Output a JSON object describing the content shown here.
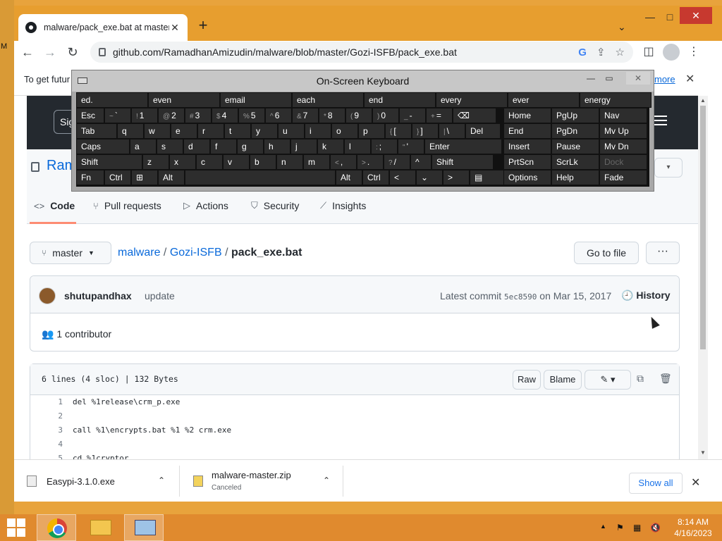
{
  "desktop": {
    "edge_letter": "M"
  },
  "browser": {
    "tab_title": "malware/pack_exe.bat at master",
    "tab_close": "✕",
    "new_tab": "+",
    "tab_menu": "⌄",
    "caption_min": "—",
    "caption_max": "□",
    "caption_close": "✕",
    "back": "←",
    "forward": "→",
    "reload": "↻",
    "url": "github.com/RamadhanAmizudin/malware/blob/master/Gozi-ISFB/pack_exe.bat",
    "google_icon": "G",
    "share_icon": "⇪",
    "star_icon": "☆",
    "sidepanel_icon": "◫",
    "menu_icon": "⋮"
  },
  "banner": {
    "text": "To get futur",
    "link": "more",
    "close": "✕"
  },
  "header": {
    "signin": "Sign"
  },
  "repo": {
    "name_partial": "Ram",
    "dropdown": "▾"
  },
  "reponav": {
    "tabs": [
      {
        "label": "Code",
        "icon": "<>"
      },
      {
        "label": "Pull requests",
        "icon": "⑂"
      },
      {
        "label": "Actions",
        "icon": "▷"
      },
      {
        "label": "Security",
        "icon": "⛉"
      },
      {
        "label": "Insights",
        "icon": "⟋"
      }
    ]
  },
  "file_nav": {
    "branch": "master",
    "crumb_repo": "malware",
    "crumb_dir": "Gozi-ISFB",
    "crumb_file": "pack_exe.bat",
    "sep": "/",
    "go_to_file": "Go to file",
    "more": "···"
  },
  "commit": {
    "author": "shutupandhax",
    "message": "update",
    "latest_prefix": "Latest commit",
    "sha": "5ec8590",
    "date": "on Mar 15, 2017",
    "history": "History",
    "contributors": "1 contributor"
  },
  "file": {
    "info": "6 lines (4 sloc)  |  132 Bytes",
    "raw": "Raw",
    "blame": "Blame",
    "lines": [
      {
        "n": "1",
        "code": "del %1release\\crm_p.exe"
      },
      {
        "n": "2",
        "code": ""
      },
      {
        "n": "3",
        "code": "call %1\\encrypts.bat %1 %2 crm.exe"
      },
      {
        "n": "4",
        "code": ""
      },
      {
        "n": "5",
        "code": "cd %1cryptor"
      }
    ]
  },
  "downloads": {
    "items": [
      {
        "name": "Easypi-3.1.0.exe",
        "status": ""
      },
      {
        "name": "malware-master.zip",
        "status": "Canceled"
      }
    ],
    "chevron": "⌃",
    "show_all": "Show all",
    "close": "✕"
  },
  "osk": {
    "title": "On-Screen Keyboard",
    "min": "—",
    "restore": "▭",
    "close": "✕",
    "suggestions": [
      "ed.",
      "even",
      "email",
      "each",
      "end",
      "every",
      "ever",
      "energy"
    ],
    "row1": [
      {
        "p": "Esc",
        "s": ""
      },
      {
        "p": "`",
        "s": "~"
      },
      {
        "p": "1",
        "s": "!"
      },
      {
        "p": "2",
        "s": "@"
      },
      {
        "p": "3",
        "s": "#"
      },
      {
        "p": "4",
        "s": "$"
      },
      {
        "p": "5",
        "s": "%"
      },
      {
        "p": "6",
        "s": "^"
      },
      {
        "p": "7",
        "s": "&"
      },
      {
        "p": "8",
        "s": "*"
      },
      {
        "p": "9",
        "s": "("
      },
      {
        "p": "0",
        "s": ")"
      },
      {
        "p": "-",
        "s": "_"
      },
      {
        "p": "=",
        "s": "+"
      },
      {
        "p": "⌫",
        "s": ""
      }
    ],
    "row2": [
      "Tab",
      "q",
      "w",
      "e",
      "r",
      "t",
      "y",
      "u",
      "i",
      "o",
      "p",
      "[",
      "]",
      "\\",
      "Del"
    ],
    "row2_sec": [
      "",
      "",
      "",
      "",
      "",
      "",
      "",
      "",
      "",
      "",
      "",
      "{",
      "}",
      "|",
      ""
    ],
    "row3": [
      "Caps",
      "a",
      "s",
      "d",
      "f",
      "g",
      "h",
      "j",
      "k",
      "l",
      ";",
      "'",
      "Enter"
    ],
    "row3_sec": [
      "",
      "",
      "",
      "",
      "",
      "",
      "",
      "",
      "",
      "",
      ":",
      "\"",
      ""
    ],
    "row4": [
      "Shift",
      "z",
      "x",
      "c",
      "v",
      "b",
      "n",
      "m",
      ",",
      ".",
      "/",
      "^",
      "Shift"
    ],
    "row4_sec": [
      "",
      "",
      "",
      "",
      "",
      "",
      "",
      "",
      "<",
      ">",
      "?",
      "",
      ""
    ],
    "row5": [
      "Fn",
      "Ctrl",
      "⊞",
      "Alt",
      "",
      "Alt",
      "Ctrl",
      "<",
      "⌄",
      ">",
      "▤"
    ],
    "nav": [
      [
        "Home",
        "PgUp",
        "Nav"
      ],
      [
        "End",
        "PgDn",
        "Mv Up"
      ],
      [
        "Insert",
        "Pause",
        "Mv Dn"
      ],
      [
        "PrtScn",
        "ScrLk",
        "Dock"
      ],
      [
        "Options",
        "Help",
        "Fade"
      ]
    ]
  },
  "taskbar": {
    "time": "8:14 AM",
    "date": "4/16/2023",
    "tray_up": "▲",
    "tray_flag": "⚑",
    "tray_net": "▦",
    "tray_vol": "🔇"
  }
}
